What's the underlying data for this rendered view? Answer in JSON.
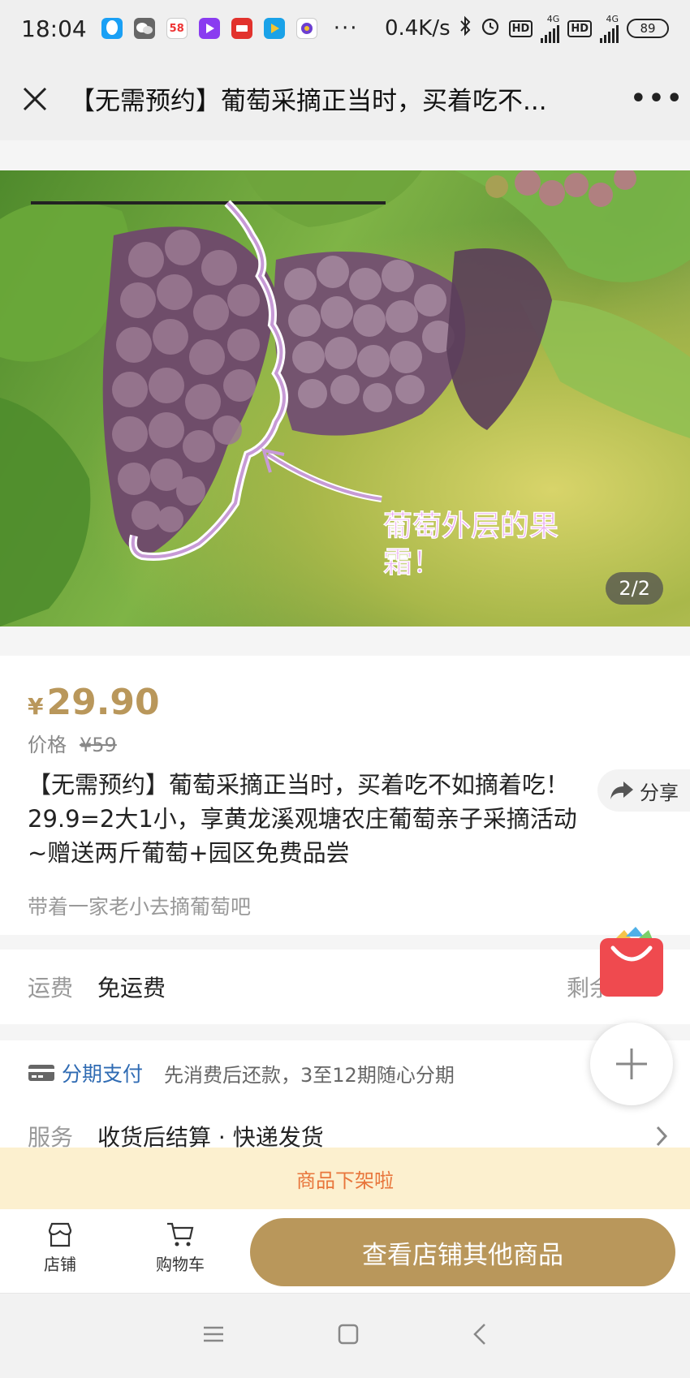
{
  "status_bar": {
    "time": "18:04",
    "net_speed": "0.4K/s",
    "hd1": "HD",
    "hd2": "HD",
    "net1": "4G",
    "net2": "4G",
    "battery": "89",
    "app_58": "58"
  },
  "titlebar": {
    "title": "【无需预约】葡萄采摘正当时，买着吃不..."
  },
  "hero": {
    "annotation_line1": "葡萄外层的果",
    "annotation_line2": "霜！",
    "pager": "2/2"
  },
  "product": {
    "currency": "¥",
    "price": "29.90",
    "orig_label": "价格",
    "orig_price": "¥59",
    "title": "【无需预约】葡萄采摘正当时，买着吃不如摘着吃！29.9=2大1小，享黄龙溪观塘农庄葡萄亲子采摘活动~赠送两斤葡萄+园区免费品尝",
    "subtitle": "带着一家老小去摘葡萄吧",
    "share_label": "分享"
  },
  "shipping": {
    "label": "运费",
    "value": "免运费",
    "remain": "剩余"
  },
  "installment": {
    "label": "分期支付",
    "desc": "先消费后还款，3至12期随心分期"
  },
  "service": {
    "label": "服务",
    "value": "收货后结算 · 快递发货"
  },
  "notice": {
    "off_shelf": "商品下架啦"
  },
  "action_bar": {
    "shop_label": "店铺",
    "cart_label": "购物车",
    "view_other": "查看店铺其他商品"
  },
  "colors": {
    "accent_gold": "#b9975b",
    "notice_bg": "#fcf0cf",
    "notice_text": "#e8763c",
    "link_blue": "#2f6bb3"
  }
}
